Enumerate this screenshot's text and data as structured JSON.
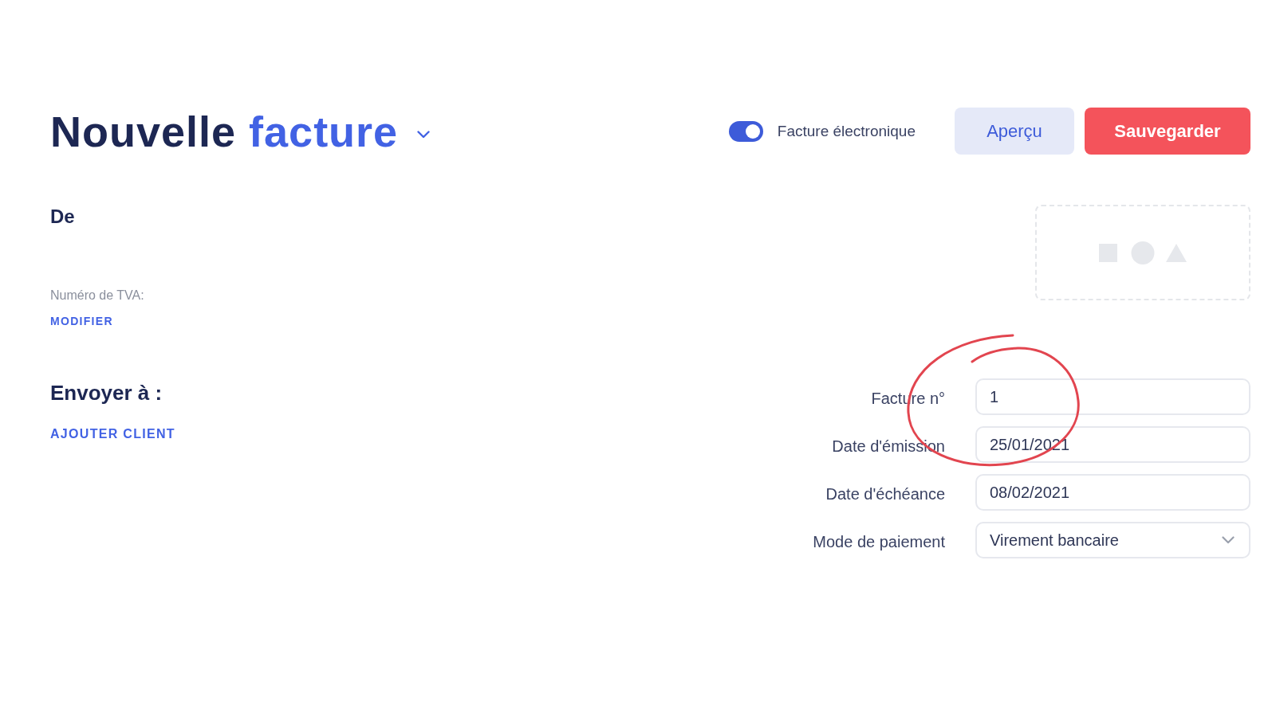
{
  "header": {
    "title": {
      "main": "Nouvelle",
      "accent": "facture"
    },
    "toggle": {
      "label": "Facture électronique",
      "on": true
    },
    "buttons": [
      {
        "label": "Aperçu",
        "kind": "secondary"
      },
      {
        "label": "Sauvegarder",
        "kind": "primary"
      }
    ]
  },
  "sender": {
    "heading": "De",
    "vat_label": "Numéro de TVA:",
    "edit_link": "MODIFIER"
  },
  "recipient": {
    "heading": "Envoyer à :",
    "add_link": "AJOUTER CLIENT"
  },
  "invoice_fields": [
    {
      "label": "Facture n°",
      "value": "1",
      "kind": "text"
    },
    {
      "label": "Date d'émission",
      "value": "25/01/2021",
      "kind": "text"
    },
    {
      "label": "Date d'échéance",
      "value": "08/02/2021",
      "kind": "text"
    },
    {
      "label": "Mode de paiement",
      "value": "Virement bancaire",
      "kind": "select"
    }
  ]
}
